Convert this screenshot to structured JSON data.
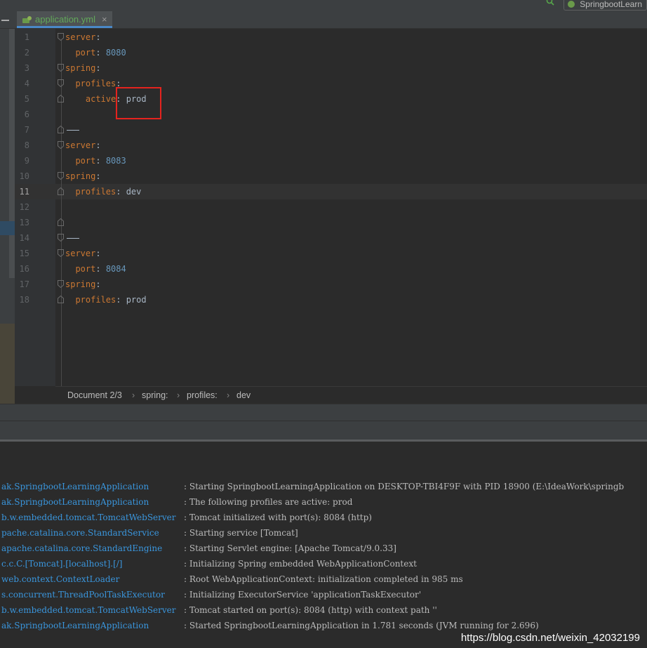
{
  "toolbar": {
    "run_config_label": "SpringbootLearn"
  },
  "editor": {
    "tab": {
      "file_name": "application.yml",
      "close_glyph": "×"
    },
    "lines": [
      {
        "num": "1",
        "parts": [
          [
            "k",
            "server"
          ],
          [
            "p",
            ":"
          ]
        ]
      },
      {
        "num": "2",
        "parts": [
          [
            "s",
            "  "
          ],
          [
            "k",
            "port"
          ],
          [
            "p",
            ": "
          ],
          [
            "n",
            "8080"
          ]
        ]
      },
      {
        "num": "3",
        "parts": [
          [
            "k",
            "spring"
          ],
          [
            "p",
            ":"
          ]
        ]
      },
      {
        "num": "4",
        "parts": [
          [
            "s",
            "  "
          ],
          [
            "k",
            "profiles"
          ],
          [
            "p",
            ":"
          ]
        ]
      },
      {
        "num": "5",
        "parts": [
          [
            "s",
            "    "
          ],
          [
            "k",
            "active"
          ],
          [
            "p",
            ": "
          ],
          [
            "v",
            "prod"
          ]
        ]
      },
      {
        "num": "6",
        "parts": []
      },
      {
        "num": "7",
        "parts": [],
        "separator": true
      },
      {
        "num": "8",
        "parts": [
          [
            "k",
            "server"
          ],
          [
            "p",
            ":"
          ]
        ]
      },
      {
        "num": "9",
        "parts": [
          [
            "s",
            "  "
          ],
          [
            "k",
            "port"
          ],
          [
            "p",
            ": "
          ],
          [
            "n",
            "8083"
          ]
        ]
      },
      {
        "num": "10",
        "parts": [
          [
            "k",
            "spring"
          ],
          [
            "p",
            ":"
          ]
        ]
      },
      {
        "num": "11",
        "parts": [
          [
            "s",
            "  "
          ],
          [
            "k",
            "profiles"
          ],
          [
            "p",
            ": "
          ],
          [
            "v",
            "dev"
          ]
        ],
        "current": true
      },
      {
        "num": "12",
        "parts": []
      },
      {
        "num": "13",
        "parts": []
      },
      {
        "num": "14",
        "parts": [],
        "separator": true
      },
      {
        "num": "15",
        "parts": [
          [
            "k",
            "server"
          ],
          [
            "p",
            ":"
          ]
        ]
      },
      {
        "num": "16",
        "parts": [
          [
            "s",
            "  "
          ],
          [
            "k",
            "port"
          ],
          [
            "p",
            ": "
          ],
          [
            "n",
            "8084"
          ]
        ]
      },
      {
        "num": "17",
        "parts": [
          [
            "k",
            "spring"
          ],
          [
            "p",
            ":"
          ]
        ]
      },
      {
        "num": "18",
        "parts": [
          [
            "s",
            "  "
          ],
          [
            "k",
            "profiles"
          ],
          [
            "p",
            ": "
          ],
          [
            "v",
            "prod"
          ]
        ]
      }
    ],
    "breadcrumbs": [
      "Document 2/3",
      "spring:",
      "profiles:",
      "dev"
    ]
  },
  "console": {
    "logs": [
      {
        "logger": "ak.SpringbootLearningApplication",
        "message": ": Starting SpringbootLearningApplication on DESKTOP-TBI4F9F with PID 18900 (E:\\IdeaWork\\springb"
      },
      {
        "logger": "ak.SpringbootLearningApplication",
        "message": ": The following profiles are active: prod"
      },
      {
        "logger": "b.w.embedded.tomcat.TomcatWebServer",
        "message": ": Tomcat initialized with port(s): 8084 (http)"
      },
      {
        "logger": "pache.catalina.core.StandardService",
        "message": ": Starting service [Tomcat]"
      },
      {
        "logger": "apache.catalina.core.StandardEngine",
        "message": ": Starting Servlet engine: [Apache Tomcat/9.0.33]"
      },
      {
        "logger": "c.c.C.[Tomcat].[localhost].[/]",
        "message": ": Initializing Spring embedded WebApplicationContext"
      },
      {
        "logger": "web.context.ContextLoader",
        "message": ": Root WebApplicationContext: initialization completed in 985 ms"
      },
      {
        "logger": "s.concurrent.ThreadPoolTaskExecutor",
        "message": ": Initializing ExecutorService 'applicationTaskExecutor'"
      },
      {
        "logger": "b.w.embedded.tomcat.TomcatWebServer",
        "message": ": Tomcat started on port(s): 8084 (http) with context path ''"
      },
      {
        "logger": "ak.SpringbootLearningApplication",
        "message": ": Started SpringbootLearningApplication in 1.781 seconds (JVM running for 2.696)"
      }
    ]
  },
  "watermark": "https://blog.csdn.net/weixin_42032199",
  "colors": {
    "keyword": "#cc7832",
    "number": "#6897bb",
    "text": "#a9b7c6",
    "logger": "#3a96dd",
    "highlight": "#e5231e"
  },
  "icons": {
    "tab_file": "yaml-file-icon",
    "search": "search-icon",
    "run_config": "spring-boot-icon"
  }
}
